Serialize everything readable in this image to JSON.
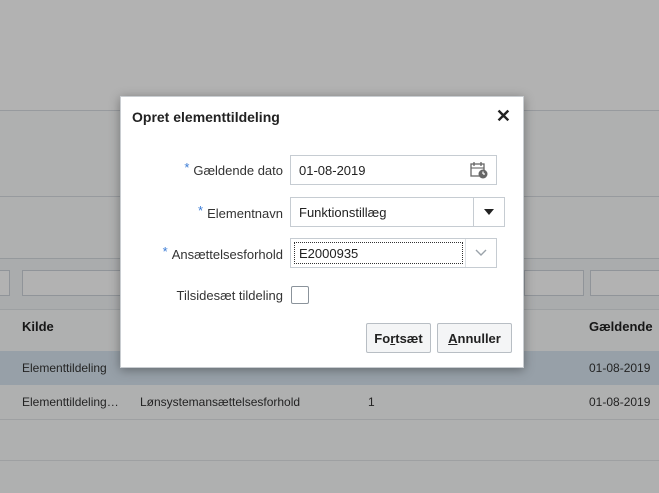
{
  "background_table": {
    "columns": {
      "source": "Kilde",
      "effective": "Gældende"
    },
    "rows": [
      {
        "source": "Elementtildeling",
        "effective": "01-08-2019"
      },
      {
        "source": "Elementtildeling…",
        "type": "Lønsystemansættelsesforhold",
        "number": "1",
        "effective": "01-08-2019"
      }
    ]
  },
  "dialog": {
    "title": "Opret elementtildeling",
    "close_glyph": "✕",
    "fields": {
      "effective_date": {
        "label": "Gældende dato",
        "value": "01-08-2019",
        "required": "*"
      },
      "element_name": {
        "label": "Elementnavn",
        "value": "Funktionstillæg",
        "required": "*"
      },
      "employment": {
        "label": "Ansættelsesforhold",
        "value": "E2000935",
        "required": "*"
      },
      "override": {
        "label": "Tilsidesæt tildeling"
      }
    },
    "buttons": {
      "continue": {
        "pre": "Fo",
        "mnemonic": "r",
        "post": "tsæt"
      },
      "cancel": {
        "pre": "",
        "mnemonic": "A",
        "post": "nnuller"
      }
    }
  },
  "colors": {
    "required_star": "#3a7bd5",
    "selected_row": "#d8e6f1",
    "overlay": "rgba(0,0,0,0.30)"
  },
  "icons": [
    "calendar-icon",
    "dropdown-triangle-icon",
    "chevron-down-icon",
    "close-icon"
  ]
}
